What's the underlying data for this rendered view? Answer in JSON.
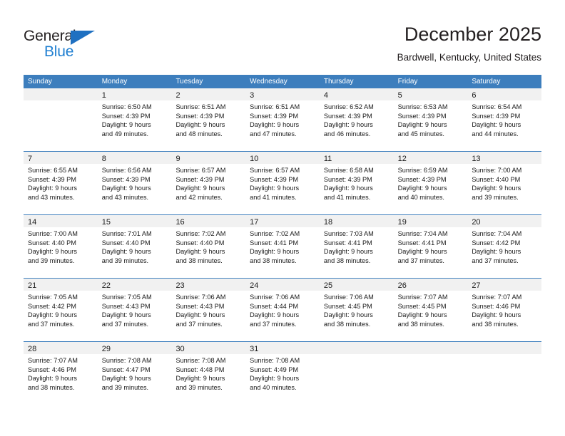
{
  "brand": {
    "name_part1": "General",
    "name_part2": "Blue",
    "triangle_color": "#1f70c1",
    "blue_color": "#1f7fd1"
  },
  "header": {
    "title": "December 2025",
    "subtitle": "Bardwell, Kentucky, United States"
  },
  "theme": {
    "header_bar": "#3d7ebd",
    "daynum_band": "#f1f1f1",
    "text": "#1a1a1a"
  },
  "weekdays": [
    "Sunday",
    "Monday",
    "Tuesday",
    "Wednesday",
    "Thursday",
    "Friday",
    "Saturday"
  ],
  "weeks": [
    [
      {
        "day": "",
        "sunrise": "",
        "sunset": "",
        "daylight1": "",
        "daylight2": ""
      },
      {
        "day": "1",
        "sunrise": "Sunrise: 6:50 AM",
        "sunset": "Sunset: 4:39 PM",
        "daylight1": "Daylight: 9 hours",
        "daylight2": "and 49 minutes."
      },
      {
        "day": "2",
        "sunrise": "Sunrise: 6:51 AM",
        "sunset": "Sunset: 4:39 PM",
        "daylight1": "Daylight: 9 hours",
        "daylight2": "and 48 minutes."
      },
      {
        "day": "3",
        "sunrise": "Sunrise: 6:51 AM",
        "sunset": "Sunset: 4:39 PM",
        "daylight1": "Daylight: 9 hours",
        "daylight2": "and 47 minutes."
      },
      {
        "day": "4",
        "sunrise": "Sunrise: 6:52 AM",
        "sunset": "Sunset: 4:39 PM",
        "daylight1": "Daylight: 9 hours",
        "daylight2": "and 46 minutes."
      },
      {
        "day": "5",
        "sunrise": "Sunrise: 6:53 AM",
        "sunset": "Sunset: 4:39 PM",
        "daylight1": "Daylight: 9 hours",
        "daylight2": "and 45 minutes."
      },
      {
        "day": "6",
        "sunrise": "Sunrise: 6:54 AM",
        "sunset": "Sunset: 4:39 PM",
        "daylight1": "Daylight: 9 hours",
        "daylight2": "and 44 minutes."
      }
    ],
    [
      {
        "day": "7",
        "sunrise": "Sunrise: 6:55 AM",
        "sunset": "Sunset: 4:39 PM",
        "daylight1": "Daylight: 9 hours",
        "daylight2": "and 43 minutes."
      },
      {
        "day": "8",
        "sunrise": "Sunrise: 6:56 AM",
        "sunset": "Sunset: 4:39 PM",
        "daylight1": "Daylight: 9 hours",
        "daylight2": "and 43 minutes."
      },
      {
        "day": "9",
        "sunrise": "Sunrise: 6:57 AM",
        "sunset": "Sunset: 4:39 PM",
        "daylight1": "Daylight: 9 hours",
        "daylight2": "and 42 minutes."
      },
      {
        "day": "10",
        "sunrise": "Sunrise: 6:57 AM",
        "sunset": "Sunset: 4:39 PM",
        "daylight1": "Daylight: 9 hours",
        "daylight2": "and 41 minutes."
      },
      {
        "day": "11",
        "sunrise": "Sunrise: 6:58 AM",
        "sunset": "Sunset: 4:39 PM",
        "daylight1": "Daylight: 9 hours",
        "daylight2": "and 41 minutes."
      },
      {
        "day": "12",
        "sunrise": "Sunrise: 6:59 AM",
        "sunset": "Sunset: 4:39 PM",
        "daylight1": "Daylight: 9 hours",
        "daylight2": "and 40 minutes."
      },
      {
        "day": "13",
        "sunrise": "Sunrise: 7:00 AM",
        "sunset": "Sunset: 4:40 PM",
        "daylight1": "Daylight: 9 hours",
        "daylight2": "and 39 minutes."
      }
    ],
    [
      {
        "day": "14",
        "sunrise": "Sunrise: 7:00 AM",
        "sunset": "Sunset: 4:40 PM",
        "daylight1": "Daylight: 9 hours",
        "daylight2": "and 39 minutes."
      },
      {
        "day": "15",
        "sunrise": "Sunrise: 7:01 AM",
        "sunset": "Sunset: 4:40 PM",
        "daylight1": "Daylight: 9 hours",
        "daylight2": "and 39 minutes."
      },
      {
        "day": "16",
        "sunrise": "Sunrise: 7:02 AM",
        "sunset": "Sunset: 4:40 PM",
        "daylight1": "Daylight: 9 hours",
        "daylight2": "and 38 minutes."
      },
      {
        "day": "17",
        "sunrise": "Sunrise: 7:02 AM",
        "sunset": "Sunset: 4:41 PM",
        "daylight1": "Daylight: 9 hours",
        "daylight2": "and 38 minutes."
      },
      {
        "day": "18",
        "sunrise": "Sunrise: 7:03 AM",
        "sunset": "Sunset: 4:41 PM",
        "daylight1": "Daylight: 9 hours",
        "daylight2": "and 38 minutes."
      },
      {
        "day": "19",
        "sunrise": "Sunrise: 7:04 AM",
        "sunset": "Sunset: 4:41 PM",
        "daylight1": "Daylight: 9 hours",
        "daylight2": "and 37 minutes."
      },
      {
        "day": "20",
        "sunrise": "Sunrise: 7:04 AM",
        "sunset": "Sunset: 4:42 PM",
        "daylight1": "Daylight: 9 hours",
        "daylight2": "and 37 minutes."
      }
    ],
    [
      {
        "day": "21",
        "sunrise": "Sunrise: 7:05 AM",
        "sunset": "Sunset: 4:42 PM",
        "daylight1": "Daylight: 9 hours",
        "daylight2": "and 37 minutes."
      },
      {
        "day": "22",
        "sunrise": "Sunrise: 7:05 AM",
        "sunset": "Sunset: 4:43 PM",
        "daylight1": "Daylight: 9 hours",
        "daylight2": "and 37 minutes."
      },
      {
        "day": "23",
        "sunrise": "Sunrise: 7:06 AM",
        "sunset": "Sunset: 4:43 PM",
        "daylight1": "Daylight: 9 hours",
        "daylight2": "and 37 minutes."
      },
      {
        "day": "24",
        "sunrise": "Sunrise: 7:06 AM",
        "sunset": "Sunset: 4:44 PM",
        "daylight1": "Daylight: 9 hours",
        "daylight2": "and 37 minutes."
      },
      {
        "day": "25",
        "sunrise": "Sunrise: 7:06 AM",
        "sunset": "Sunset: 4:45 PM",
        "daylight1": "Daylight: 9 hours",
        "daylight2": "and 38 minutes."
      },
      {
        "day": "26",
        "sunrise": "Sunrise: 7:07 AM",
        "sunset": "Sunset: 4:45 PM",
        "daylight1": "Daylight: 9 hours",
        "daylight2": "and 38 minutes."
      },
      {
        "day": "27",
        "sunrise": "Sunrise: 7:07 AM",
        "sunset": "Sunset: 4:46 PM",
        "daylight1": "Daylight: 9 hours",
        "daylight2": "and 38 minutes."
      }
    ],
    [
      {
        "day": "28",
        "sunrise": "Sunrise: 7:07 AM",
        "sunset": "Sunset: 4:46 PM",
        "daylight1": "Daylight: 9 hours",
        "daylight2": "and 38 minutes."
      },
      {
        "day": "29",
        "sunrise": "Sunrise: 7:08 AM",
        "sunset": "Sunset: 4:47 PM",
        "daylight1": "Daylight: 9 hours",
        "daylight2": "and 39 minutes."
      },
      {
        "day": "30",
        "sunrise": "Sunrise: 7:08 AM",
        "sunset": "Sunset: 4:48 PM",
        "daylight1": "Daylight: 9 hours",
        "daylight2": "and 39 minutes."
      },
      {
        "day": "31",
        "sunrise": "Sunrise: 7:08 AM",
        "sunset": "Sunset: 4:49 PM",
        "daylight1": "Daylight: 9 hours",
        "daylight2": "and 40 minutes."
      },
      {
        "day": "",
        "sunrise": "",
        "sunset": "",
        "daylight1": "",
        "daylight2": ""
      },
      {
        "day": "",
        "sunrise": "",
        "sunset": "",
        "daylight1": "",
        "daylight2": ""
      },
      {
        "day": "",
        "sunrise": "",
        "sunset": "",
        "daylight1": "",
        "daylight2": ""
      }
    ]
  ]
}
